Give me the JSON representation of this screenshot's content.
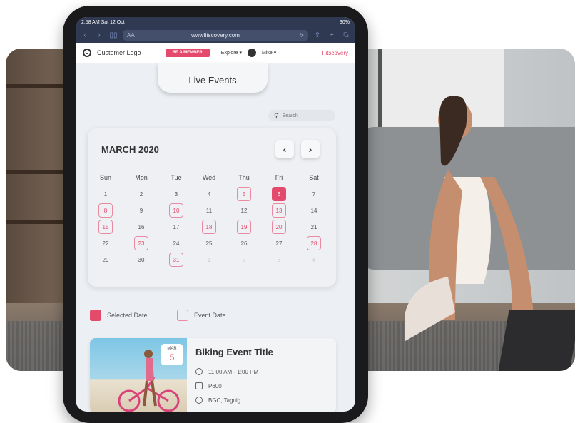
{
  "statusbar": {
    "time": "2:58 AM  Sat 12 Oct",
    "battery": "30%"
  },
  "browser": {
    "url": "wwwfitscovery.com",
    "text_size_label": "AA"
  },
  "header": {
    "logo_text": "Customer Logo",
    "logo_letter": "C",
    "member_button": "BE A MEMBER",
    "explore_label": "Explore",
    "user_label": "Mike",
    "brand_text": "Fitscovery"
  },
  "page": {
    "tab_title": "Live Events"
  },
  "search": {
    "placeholder": "Search"
  },
  "calendar": {
    "month_label": "MARCH 2020",
    "weekdays": [
      "Sun",
      "Mon",
      "Tue",
      "Wed",
      "Thu",
      "Fri",
      "Sat"
    ],
    "weeks": [
      [
        "1",
        "2",
        "3",
        "4",
        "5",
        "6",
        "7"
      ],
      [
        "8",
        "9",
        "10",
        "11",
        "12",
        "13",
        "14"
      ],
      [
        "15",
        "16",
        "17",
        "18",
        "19",
        "20",
        "21"
      ],
      [
        "22",
        "23",
        "24",
        "25",
        "26",
        "27",
        "28"
      ],
      [
        "29",
        "30",
        "31",
        "1",
        "2",
        "3",
        "4"
      ]
    ],
    "event_days": [
      "5",
      "8",
      "10",
      "13",
      "15",
      "18",
      "19",
      "20",
      "23",
      "28",
      "31"
    ],
    "selected_day": "6"
  },
  "legend": {
    "selected_label": "Selected Date",
    "event_label": "Event Date"
  },
  "event": {
    "badge_month": "MAR",
    "badge_day": "5",
    "title": "Biking Event Title",
    "time": "11:00 AM - 1:00 PM",
    "price": "P600",
    "location": "BGC, Taguig"
  },
  "colors": {
    "accent": "#e44a6b",
    "browser_bar": "#2f3a52"
  }
}
